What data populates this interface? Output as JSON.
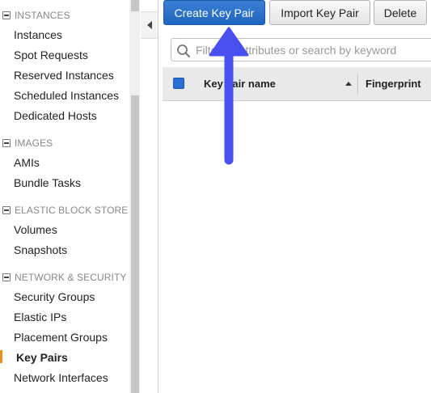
{
  "sidebar": {
    "sections": [
      {
        "title": "INSTANCES",
        "items": [
          "Instances",
          "Spot Requests",
          "Reserved Instances",
          "Scheduled Instances",
          "Dedicated Hosts"
        ]
      },
      {
        "title": "IMAGES",
        "items": [
          "AMIs",
          "Bundle Tasks"
        ]
      },
      {
        "title": "ELASTIC BLOCK STORE",
        "items": [
          "Volumes",
          "Snapshots"
        ]
      },
      {
        "title": "NETWORK & SECURITY",
        "items": [
          "Security Groups",
          "Elastic IPs",
          "Placement Groups",
          "Key Pairs",
          "Network Interfaces"
        ]
      }
    ],
    "active_item": "Key Pairs",
    "accent_color": "#e7901b"
  },
  "toolbar": {
    "create_label": "Create Key Pair",
    "import_label": "Import Key Pair",
    "delete_label": "Delete"
  },
  "search": {
    "placeholder": "Filter by attributes or search by keyword"
  },
  "table": {
    "columns": [
      "Key pair name",
      "Fingerprint"
    ],
    "sort": "ascending",
    "rows": []
  },
  "annotation": {
    "type": "arrow",
    "points_to": "Create Key Pair",
    "color": "#4a4ff0"
  }
}
